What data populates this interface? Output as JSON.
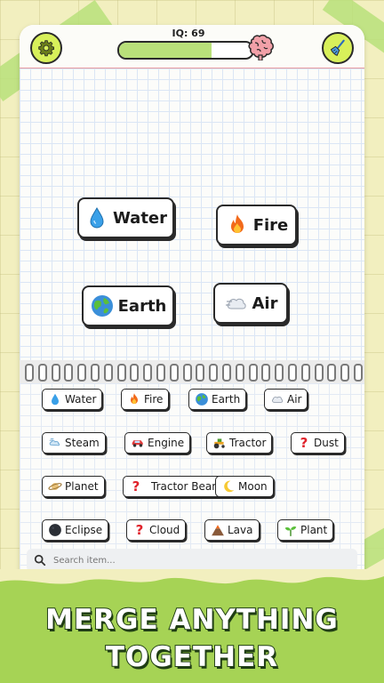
{
  "header": {
    "iq_label": "IQ: 69",
    "iq_progress": 0.69
  },
  "board": {
    "chips": [
      {
        "label": "Water",
        "icon": "water-drop-icon"
      },
      {
        "label": "Fire",
        "icon": "fire-icon"
      },
      {
        "label": "Earth",
        "icon": "earth-globe-icon"
      },
      {
        "label": "Air",
        "icon": "wind-cloud-icon"
      }
    ]
  },
  "inventory": {
    "items": [
      {
        "label": "Water",
        "icon": "water-drop-icon"
      },
      {
        "label": "Fire",
        "icon": "fire-icon"
      },
      {
        "label": "Earth",
        "icon": "earth-globe-icon"
      },
      {
        "label": "Air",
        "icon": "wind-cloud-icon"
      },
      {
        "label": "Steam",
        "icon": "steam-icon"
      },
      {
        "label": "Engine",
        "icon": "car-icon"
      },
      {
        "label": "Tractor",
        "icon": "tractor-icon"
      },
      {
        "label": "Dust",
        "icon": "question-mark-icon"
      },
      {
        "label": "Planet",
        "icon": "ringed-planet-icon"
      },
      {
        "label": "Tractor Beam",
        "icon": "question-mark-icon"
      },
      {
        "label": "Moon",
        "icon": "crescent-moon-icon"
      },
      {
        "label": "Eclipse",
        "icon": "new-moon-icon"
      },
      {
        "label": "Cloud",
        "icon": "question-mark-icon"
      },
      {
        "label": "Lava",
        "icon": "volcano-icon"
      },
      {
        "label": "Plant",
        "icon": "seedling-icon"
      }
    ]
  },
  "search": {
    "placeholder": "Search item..."
  },
  "banner": {
    "line1": "MERGE ANYTHING",
    "line2": "TOGETHER"
  },
  "colors": {
    "accent_green": "#b9e07a",
    "banner_green": "#a6d355",
    "button_yellow": "#d8f05a",
    "outline": "#2a2a2a"
  }
}
